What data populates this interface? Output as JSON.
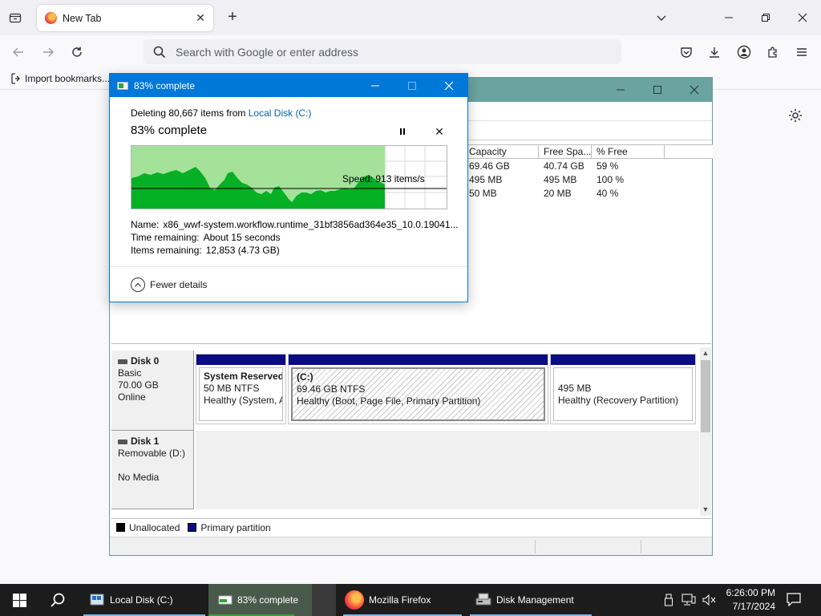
{
  "browser": {
    "tab_title": "New Tab",
    "url_placeholder": "Search with Google or enter address",
    "bookmarks": [
      {
        "label": "Import bookmarks..."
      }
    ]
  },
  "disk_management": {
    "columns": [
      "Capacity",
      "Free Spa...",
      "% Free"
    ],
    "volumes": [
      {
        "capacity": "69.46 GB",
        "free": "40.74 GB",
        "pct_free": "59 %"
      },
      {
        "capacity": "495 MB",
        "free": "495 MB",
        "pct_free": "100 %"
      },
      {
        "capacity": "50 MB",
        "free": "20 MB",
        "pct_free": "40 %"
      }
    ],
    "disks": [
      {
        "name": "Disk 0",
        "type": "Basic",
        "size": "70.00 GB",
        "status": "Online",
        "partitions": [
          {
            "name": "System Reserved",
            "size": "50 MB NTFS",
            "status": "Healthy (System, A"
          },
          {
            "name": "(C:)",
            "size": "69.46 GB NTFS",
            "status": "Healthy (Boot, Page File, Primary Partition)"
          },
          {
            "name": "",
            "size": "495 MB",
            "status": "Healthy (Recovery Partition)"
          }
        ]
      },
      {
        "name": "Disk 1",
        "type": "Removable (D:)",
        "media": "No Media"
      }
    ],
    "legend": [
      {
        "label": "Unallocated",
        "color": "#000000"
      },
      {
        "label": "Primary partition",
        "color": "#0b0b82"
      }
    ]
  },
  "dialog": {
    "title": "83% complete",
    "line1_prefix": "Deleting 80,667 items from ",
    "line1_link": "Local Disk (C:)",
    "percent_text": "83% complete",
    "progress": 0.83,
    "speed": "Speed: 913 items/s",
    "name_label": "Name:",
    "name_value": "x86_wwf-system.workflow.runtime_31bf3856ad364e35_10.0.19041...",
    "time_label": "Time remaining:",
    "time_value": "About 15 seconds",
    "items_label": "Items remaining:",
    "items_value": "12,853 (4.73 GB)",
    "fewer_details": "Fewer details",
    "accent": "#0078d7",
    "graph_fill": "#06b025",
    "graph_bg": "#a4e29a"
  },
  "taskbar": {
    "apps": [
      {
        "label": "Local Disk (C:)"
      },
      {
        "label": "83% complete"
      },
      {
        "label": "Mozilla Firefox"
      },
      {
        "label": "Disk Management"
      }
    ],
    "time": "6:26:00 PM",
    "date": "7/17/2024"
  }
}
